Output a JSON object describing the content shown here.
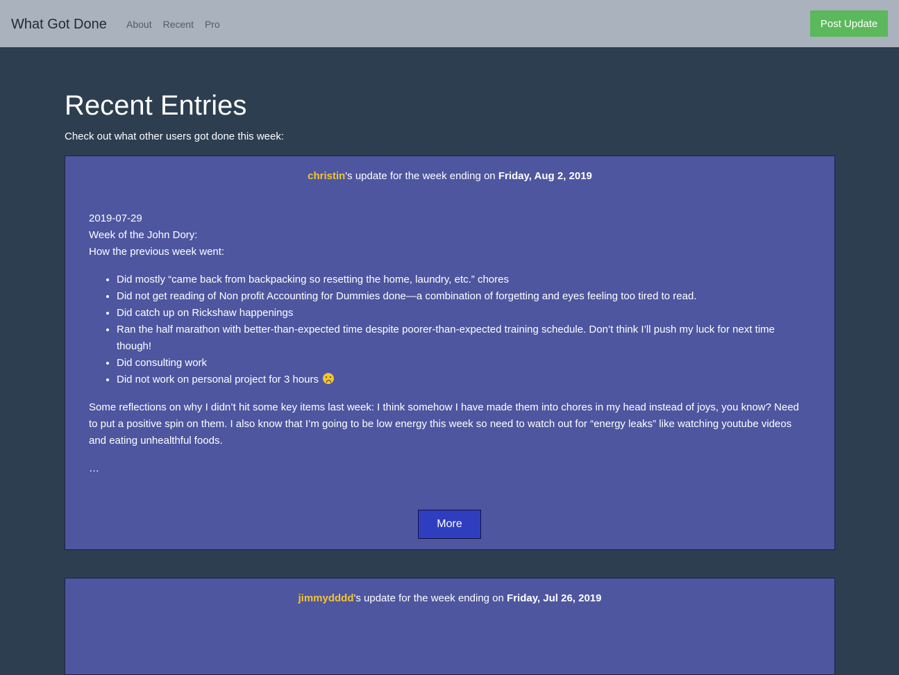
{
  "navbar": {
    "brand": "What Got Done",
    "links": [
      "About",
      "Recent",
      "Pro"
    ],
    "post_button": "Post Update",
    "colors": {
      "background": "#aab2bd",
      "post_button": "#5cb85c"
    }
  },
  "main": {
    "title": "Recent Entries",
    "subtitle": "Check out what other users got done this week:"
  },
  "entries": [
    {
      "username": "christin",
      "header_middle": "'s update for the week ending on ",
      "date": "Friday, Aug 2, 2019",
      "lines": [
        "2019-07-29",
        "Week of the John Dory:",
        "How the previous week went:"
      ],
      "bullets": [
        "Did mostly “came back from backpacking so resetting the home, laundry, etc.” chores",
        "Did not get reading of Non profit Accounting for Dummies done—a combination of forgetting and eyes feeling too tired to read.",
        "Did catch up on Rickshaw happenings",
        "Ran the half marathon with better-than-expected time despite poorer-than-expected training schedule. Don’t think I’ll push my luck for next time though!",
        "Did consulting work",
        "Did not work on personal project for 3 hours"
      ],
      "reflection": "Some reflections on why I didn’t hit some key items last week: I think somehow I have made them into chores in my head instead of joys, you know? Need to put a positive spin on them. I also know that I’m going to be low energy this week so need to watch out for “energy leaks” like watching youtube videos and eating unhealthful foods.",
      "ellipsis": "…",
      "more_button": "More",
      "emoji_icon": "frowning-face-icon"
    },
    {
      "username": "jimmydddd",
      "header_middle": "'s update for the week ending on ",
      "date": "Friday, Jul 26, 2019"
    }
  ],
  "colors": {
    "page_background": "#2d3e50",
    "card_background": "#4e56a0",
    "username": "#f4c430",
    "more_button": "#2f3dbf"
  }
}
